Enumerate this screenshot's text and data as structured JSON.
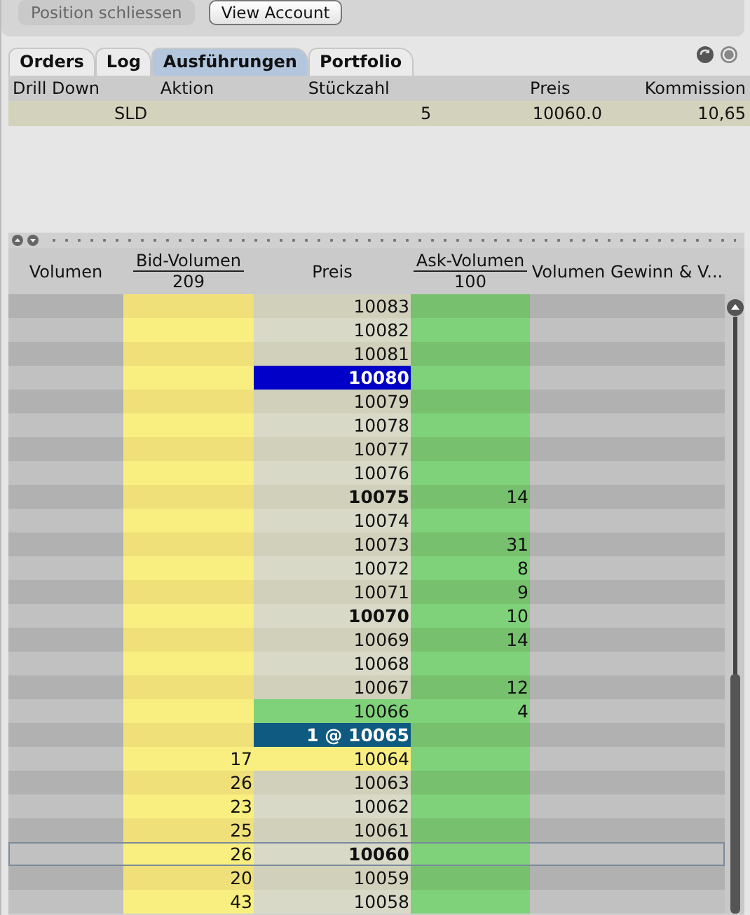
{
  "toolbar": {
    "buttons": [
      {
        "label": "Position schliessen",
        "disabled": true
      },
      {
        "label": "View Account",
        "disabled": false
      }
    ]
  },
  "tabs": [
    {
      "label": "Orders",
      "selected": false
    },
    {
      "label": "Log",
      "selected": false
    },
    {
      "label": "Ausführungen",
      "selected": true
    },
    {
      "label": "Portfolio",
      "selected": false
    }
  ],
  "executions": {
    "columns": [
      "Drill Down",
      "Aktion",
      "Stückzahl",
      "Preis",
      "Kommission"
    ],
    "rows": [
      {
        "aktion": "SLD",
        "stueckzahl": "5",
        "preis": "10060.0",
        "kommission": "10,65"
      }
    ]
  },
  "book": {
    "columns": [
      {
        "label": "Volumen"
      },
      {
        "label": "Bid-Volumen",
        "total": "209"
      },
      {
        "label": "Preis"
      },
      {
        "label": "Ask-Volumen",
        "total": "100"
      },
      {
        "label": "Volumen Gewinn & V..."
      }
    ],
    "rows": [
      {
        "price": "10083",
        "bid": "",
        "ask": "",
        "bold": false,
        "kind": "plain",
        "selected": false
      },
      {
        "price": "10082",
        "bid": "",
        "ask": "",
        "bold": false,
        "kind": "plain",
        "selected": false
      },
      {
        "price": "10081",
        "bid": "",
        "ask": "",
        "bold": false,
        "kind": "plain",
        "selected": false
      },
      {
        "price": "10080",
        "bid": "",
        "ask": "",
        "bold": true,
        "kind": "last",
        "selected": false
      },
      {
        "price": "10079",
        "bid": "",
        "ask": "",
        "bold": false,
        "kind": "plain",
        "selected": false
      },
      {
        "price": "10078",
        "bid": "",
        "ask": "",
        "bold": false,
        "kind": "plain",
        "selected": false
      },
      {
        "price": "10077",
        "bid": "",
        "ask": "",
        "bold": false,
        "kind": "plain",
        "selected": false
      },
      {
        "price": "10076",
        "bid": "",
        "ask": "",
        "bold": false,
        "kind": "plain",
        "selected": false
      },
      {
        "price": "10075",
        "bid": "",
        "ask": "14",
        "bold": true,
        "kind": "plain",
        "selected": false
      },
      {
        "price": "10074",
        "bid": "",
        "ask": "",
        "bold": false,
        "kind": "plain",
        "selected": false
      },
      {
        "price": "10073",
        "bid": "",
        "ask": "31",
        "bold": false,
        "kind": "plain",
        "selected": false
      },
      {
        "price": "10072",
        "bid": "",
        "ask": "8",
        "bold": false,
        "kind": "plain",
        "selected": false
      },
      {
        "price": "10071",
        "bid": "",
        "ask": "9",
        "bold": false,
        "kind": "plain",
        "selected": false
      },
      {
        "price": "10070",
        "bid": "",
        "ask": "10",
        "bold": true,
        "kind": "plain",
        "selected": false
      },
      {
        "price": "10069",
        "bid": "",
        "ask": "14",
        "bold": false,
        "kind": "plain",
        "selected": false
      },
      {
        "price": "10068",
        "bid": "",
        "ask": "",
        "bold": false,
        "kind": "plain",
        "selected": false
      },
      {
        "price": "10067",
        "bid": "",
        "ask": "12",
        "bold": false,
        "kind": "plain",
        "selected": false
      },
      {
        "price": "10066",
        "bid": "",
        "ask": "4",
        "bold": false,
        "kind": "ask",
        "selected": false
      },
      {
        "price": "1 @ 10065",
        "bid": "",
        "ask": "",
        "bold": true,
        "kind": "order",
        "selected": false
      },
      {
        "price": "10064",
        "bid": "17",
        "ask": "",
        "bold": false,
        "kind": "bid",
        "selected": false
      },
      {
        "price": "10063",
        "bid": "26",
        "ask": "",
        "bold": false,
        "kind": "plain",
        "selected": false
      },
      {
        "price": "10062",
        "bid": "23",
        "ask": "",
        "bold": false,
        "kind": "plain",
        "selected": false
      },
      {
        "price": "10061",
        "bid": "25",
        "ask": "",
        "bold": false,
        "kind": "plain",
        "selected": false
      },
      {
        "price": "10060",
        "bid": "26",
        "ask": "",
        "bold": true,
        "kind": "plain",
        "selected": true
      },
      {
        "price": "10059",
        "bid": "20",
        "ask": "",
        "bold": false,
        "kind": "plain",
        "selected": false
      },
      {
        "price": "10058",
        "bid": "43",
        "ask": "",
        "bold": false,
        "kind": "plain",
        "selected": false
      }
    ]
  }
}
